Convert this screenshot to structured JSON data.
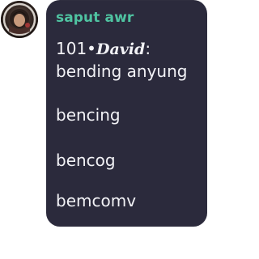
{
  "message": {
    "sender": "saput awr",
    "line1_prefix": "101•",
    "line1_name": "David",
    "line1_suffix": ":",
    "lines": [
      "bending anyung",
      "bencing",
      "bencog",
      "bemcomv"
    ]
  },
  "colors": {
    "bubble": "#2b2a3c",
    "sender": "#4fc3a1",
    "text": "#f2f2f6"
  },
  "icons": {
    "avatar": "avatar-photo-icon"
  }
}
